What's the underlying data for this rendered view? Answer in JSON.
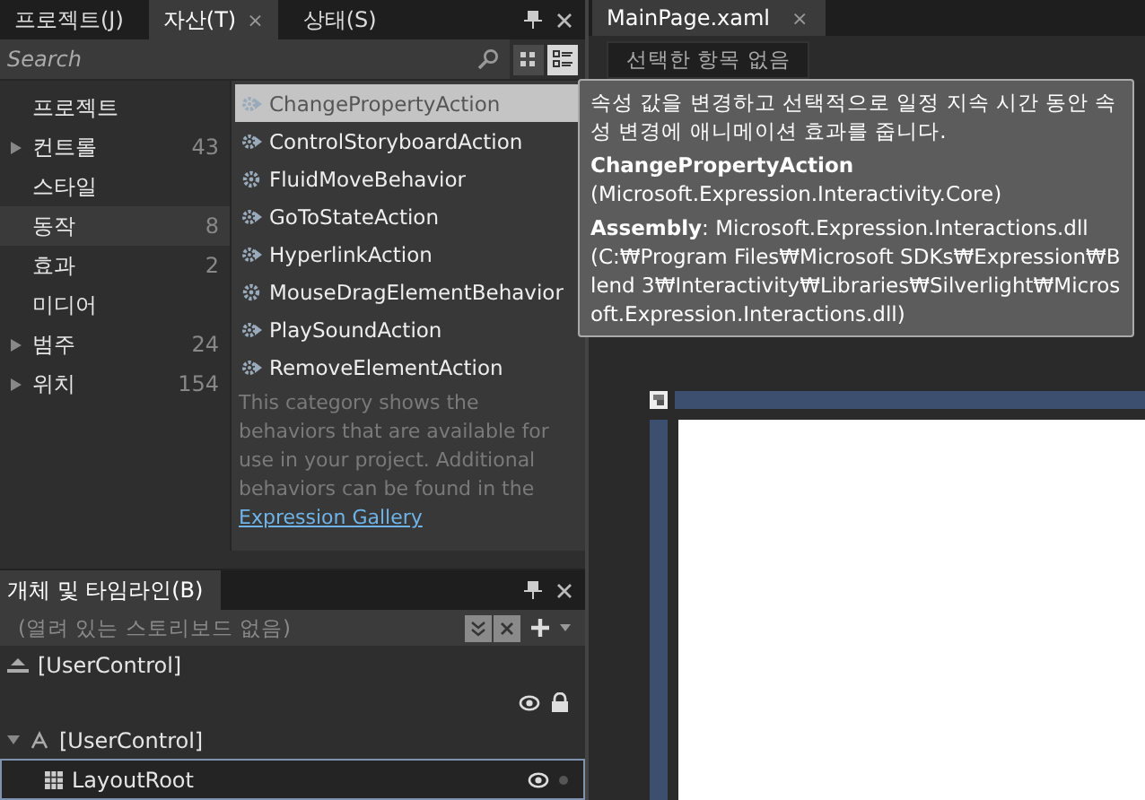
{
  "left_tabs": [
    {
      "label": "프로젝트(J)",
      "selected": false
    },
    {
      "label": "자산(T)",
      "selected": true,
      "close": "×"
    },
    {
      "label": "상태(S)",
      "selected": false
    }
  ],
  "search": {
    "placeholder": "Search"
  },
  "view_modes": [
    {
      "kind": "grid",
      "selected": false
    },
    {
      "kind": "list",
      "selected": true
    }
  ],
  "categories": [
    {
      "label": "프로젝트",
      "expandable": false,
      "selected": false
    },
    {
      "label": "컨트롤",
      "count": "43",
      "expandable": true,
      "selected": false
    },
    {
      "label": "스타일",
      "expandable": false,
      "selected": false
    },
    {
      "label": "동작",
      "count": "8",
      "expandable": false,
      "selected": true
    },
    {
      "label": "효과",
      "count": "2",
      "expandable": false,
      "selected": false
    },
    {
      "label": "미디어",
      "expandable": false,
      "selected": false
    },
    {
      "label": "범주",
      "count": "24",
      "expandable": true,
      "selected": false
    },
    {
      "label": "위치",
      "count": "154",
      "expandable": true,
      "selected": false
    }
  ],
  "assets": [
    {
      "name": "ChangePropertyAction",
      "kind": "action",
      "selected": true
    },
    {
      "name": "ControlStoryboardAction",
      "kind": "action",
      "selected": false
    },
    {
      "name": "FluidMoveBehavior",
      "kind": "behavior",
      "selected": false
    },
    {
      "name": "GoToStateAction",
      "kind": "action",
      "selected": false
    },
    {
      "name": "HyperlinkAction",
      "kind": "action",
      "selected": false
    },
    {
      "name": "MouseDragElementBehavior",
      "kind": "behavior",
      "selected": false
    },
    {
      "name": "PlaySoundAction",
      "kind": "action",
      "selected": false
    },
    {
      "name": "RemoveElementAction",
      "kind": "action",
      "selected": false
    }
  ],
  "asset_note": "This category shows the behaviors that are available for use in your project. Additional behaviors can be found in the",
  "asset_link": "Expression Gallery",
  "objects_panel": {
    "title": "개체 및 타임라인(B)",
    "storyboard_placeholder": "(열려 있는 스토리보드 없음)",
    "scope": "[UserControl]",
    "tree": [
      {
        "label": "[UserControl]",
        "expanded": true,
        "selected": false,
        "children": [
          {
            "label": "LayoutRoot",
            "selected": true
          }
        ]
      }
    ]
  },
  "document_tab": {
    "title": "MainPage.xaml",
    "close": "×"
  },
  "selection_button": "선택한 항목 없음",
  "tooltip": {
    "description": "속성 값을 변경하고 선택적으로 일정 지속 시간 동안 속성 변경에 애니메이션 효과를 줍니다.",
    "name": "ChangePropertyAction",
    "namespace": "(Microsoft.Expression.Interactivity.Core)",
    "assembly": "**Assembly**: Microsoft.Expression.Interactions.dll (C:₩Program Files₩Microsoft SDKs₩Expression₩Blend 3₩Interactivity₩Libraries₩Silverlight₩Microsoft.Expression.Interactions.dll)"
  }
}
